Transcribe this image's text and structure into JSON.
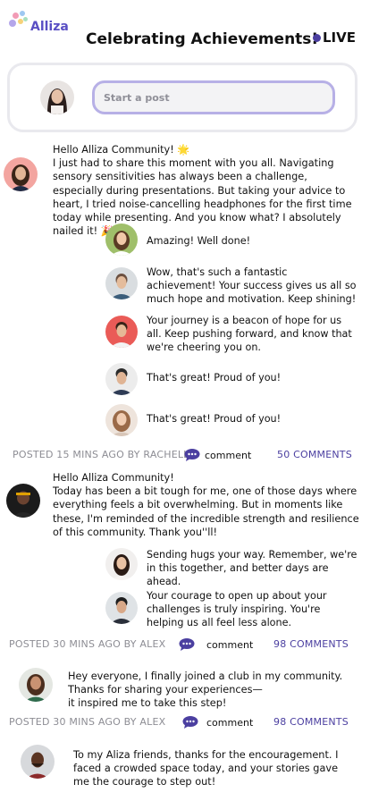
{
  "app": {
    "logo_text": "Alliza",
    "title": "Celebrating Achievements!",
    "live_label": "LIVE"
  },
  "composer": {
    "placeholder": "Start a post"
  },
  "posts": [
    {
      "text": "Hello Alliza Community! 🌟\nI just had to share this moment with you all. Navigating sensory sensitivities has always been a challenge, especially during presentations. But taking your advice to heart, I tried noise-cancelling headphones for the first time today while presenting. And you know what? I absolutely nailed it! 🎉",
      "replies": [
        {
          "text": "Amazing! Well done!"
        },
        {
          "text": "Wow, that's such a fantastic achievement! Your success gives us all so much hope and motivation. Keep shining!"
        },
        {
          "text": "Your journey is a beacon of hope for us all. Keep pushing forward, and know that we're cheering you on."
        },
        {
          "text": "That's great! Proud of you!"
        },
        {
          "text": "That's great! Proud of you!"
        }
      ],
      "meta": {
        "posted": "POSTED 15 MINS AGO BY RACHELLE",
        "comment_label": "comment",
        "comments_count": "50 COMMENTS"
      }
    },
    {
      "text": "Hello Alliza Community!\nToday has been a bit tough for me, one of those days where everything feels a bit overwhelming. But in moments like these, I'm reminded of the incredible strength and resilience of this community. Thank you''ll!",
      "replies": [
        {
          "text": "Sending hugs your way. Remember, we're in this together, and better days are ahead."
        },
        {
          "text": "Your courage to open up about your challenges is truly inspiring. You're helping us all feel less alone."
        }
      ],
      "meta": {
        "posted": "POSTED 30 MINS AGO BY ALEX",
        "comment_label": "comment",
        "comments_count": "98 COMMENTS"
      }
    },
    {
      "text": "Hey everyone, I finally joined a club in my community. Thanks for sharing your experiences—\nit inspired me to take this step!",
      "meta": {
        "posted": "POSTED 30 MINS AGO BY ALEX",
        "comment_label": "comment",
        "comments_count": "98 COMMENTS"
      }
    },
    {
      "text": "To my Aliza friends, thanks for the encouragement. I faced a crowded space today, and your stories gave me the courage to step out!"
    }
  ],
  "colors": {
    "accent": "#4b3fa0",
    "input_border": "#b7b0e6",
    "meta_gray": "#8d8d94"
  },
  "icons": {
    "comment": "comment-bubble-icon",
    "live": "live-dot-icon"
  }
}
